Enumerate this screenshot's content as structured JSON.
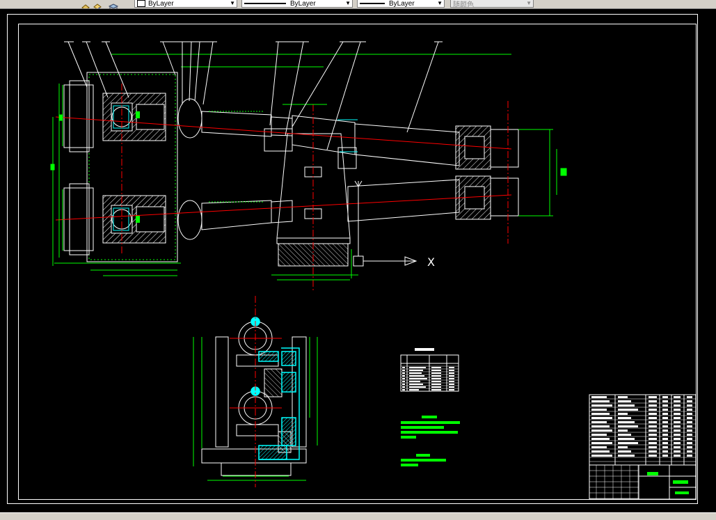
{
  "toolbar": {
    "color_combo": {
      "value": "ByLayer"
    },
    "linetype_combo": {
      "value": "ByLayer"
    },
    "lineweight_combo": {
      "value": "ByLayer"
    },
    "plotstyle_combo": {
      "value": "随颜色"
    }
  },
  "drawing": {
    "axis_label": "X",
    "colors": {
      "background": "#000000",
      "frame": "#ffffff",
      "outline": "#ffffff",
      "dimension": "#00ff00",
      "centerline": "#ff0000",
      "hatch": "#ffffff",
      "accent": "#00ffff",
      "highlight": "#00ff00"
    }
  }
}
